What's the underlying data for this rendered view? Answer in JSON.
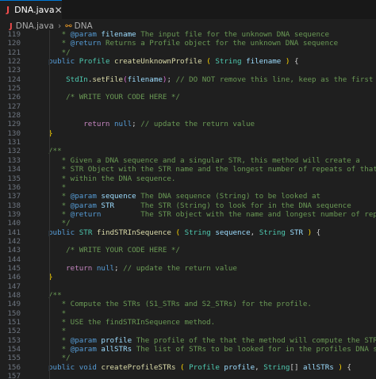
{
  "tab": {
    "label": "DNA.java",
    "icon": "java-file-icon",
    "accent": "#0078d4"
  },
  "breadcrumb": {
    "file": "DNA.java",
    "symbol": "DNA"
  },
  "colors": {
    "background": "#1f1f1f",
    "comment": "#6a9955",
    "type": "#4ec9b0",
    "function": "#dcdcaa",
    "variable": "#9cdcfe",
    "keyword": "#569cd6",
    "control": "#c586c0",
    "line_number": "#6e7681"
  },
  "lines": [
    {
      "n": "119",
      "s": [
        [
          "c",
          "   * "
        ],
        [
          "tag",
          "@param"
        ],
        [
          "c",
          " "
        ],
        [
          "tp",
          "filename"
        ],
        [
          "c",
          " The input file for the unknown DNA sequence"
        ]
      ]
    },
    {
      "n": "120",
      "s": [
        [
          "c",
          "   * "
        ],
        [
          "tag",
          "@return"
        ],
        [
          "c",
          " Returns a Profile object for the unknown DNA sequence"
        ]
      ]
    },
    {
      "n": "121",
      "s": [
        [
          "c",
          "   */"
        ]
      ]
    },
    {
      "n": "122",
      "s": [
        [
          "k",
          "public"
        ],
        [
          "p",
          " "
        ],
        [
          "t",
          "Profile"
        ],
        [
          "p",
          " "
        ],
        [
          "f",
          "createUnknownProfile"
        ],
        [
          "p",
          " "
        ],
        [
          "y",
          "("
        ],
        [
          "p",
          " "
        ],
        [
          "t",
          "String"
        ],
        [
          "p",
          " "
        ],
        [
          "v",
          "filename"
        ],
        [
          "p",
          " "
        ],
        [
          "y",
          ")"
        ],
        [
          "p",
          " {"
        ]
      ]
    },
    {
      "n": "123",
      "s": []
    },
    {
      "n": "124",
      "s": [
        [
          "p",
          "    "
        ],
        [
          "t",
          "StdIn"
        ],
        [
          "p",
          "."
        ],
        [
          "f",
          "setFile"
        ],
        [
          "pk",
          "("
        ],
        [
          "v",
          "filename"
        ],
        [
          "pk",
          ")"
        ],
        [
          "p",
          "; "
        ],
        [
          "c",
          "// DO NOT remove this line, keep as the first line in the method."
        ]
      ]
    },
    {
      "n": "125",
      "s": []
    },
    {
      "n": "126",
      "s": [
        [
          "p",
          "    "
        ],
        [
          "c",
          "/* WRITE YOUR CODE HERE */"
        ]
      ]
    },
    {
      "n": "127",
      "s": []
    },
    {
      "n": "128",
      "s": []
    },
    {
      "n": "129",
      "s": [
        [
          "p",
          "        "
        ],
        [
          "kc",
          "return"
        ],
        [
          "p",
          " "
        ],
        [
          "k",
          "null"
        ],
        [
          "p",
          "; "
        ],
        [
          "c",
          "// update the return value"
        ]
      ]
    },
    {
      "n": "130",
      "s": [
        [
          "y",
          "}"
        ]
      ]
    },
    {
      "n": "131",
      "s": []
    },
    {
      "n": "132",
      "s": [
        [
          "c",
          "/**"
        ]
      ]
    },
    {
      "n": "133",
      "s": [
        [
          "c",
          "   * Given a DNA sequence and a singular STR, this method will create a"
        ]
      ]
    },
    {
      "n": "134",
      "s": [
        [
          "c",
          "   * STR Object with the STR name and the longest number of repeats of that STR"
        ]
      ]
    },
    {
      "n": "135",
      "s": [
        [
          "c",
          "   * within the DNA sequence."
        ]
      ]
    },
    {
      "n": "136",
      "s": [
        [
          "c",
          "   *"
        ]
      ]
    },
    {
      "n": "137",
      "s": [
        [
          "c",
          "   * "
        ],
        [
          "tag",
          "@param"
        ],
        [
          "c",
          " "
        ],
        [
          "tp",
          "sequence"
        ],
        [
          "c",
          " The DNA sequence (String) to be looked at"
        ]
      ]
    },
    {
      "n": "138",
      "s": [
        [
          "c",
          "   * "
        ],
        [
          "tag",
          "@param"
        ],
        [
          "c",
          " "
        ],
        [
          "tp",
          "STR"
        ],
        [
          "c",
          "      The STR (String) to look for in the DNA sequence"
        ]
      ]
    },
    {
      "n": "139",
      "s": [
        [
          "c",
          "   * "
        ],
        [
          "tag",
          "@return"
        ],
        [
          "c",
          "         The STR object with the name and longest number of repeats"
        ]
      ]
    },
    {
      "n": "140",
      "s": [
        [
          "c",
          "   */"
        ]
      ]
    },
    {
      "n": "141",
      "s": [
        [
          "k",
          "public"
        ],
        [
          "p",
          " "
        ],
        [
          "t",
          "STR"
        ],
        [
          "p",
          " "
        ],
        [
          "f",
          "findSTRInSequence"
        ],
        [
          "p",
          " "
        ],
        [
          "y",
          "("
        ],
        [
          "p",
          " "
        ],
        [
          "t",
          "String"
        ],
        [
          "p",
          " "
        ],
        [
          "v",
          "sequence"
        ],
        [
          "p",
          ", "
        ],
        [
          "t",
          "String"
        ],
        [
          "p",
          " "
        ],
        [
          "v",
          "STR"
        ],
        [
          "p",
          " "
        ],
        [
          "y",
          ")"
        ],
        [
          "p",
          " {"
        ]
      ]
    },
    {
      "n": "142",
      "s": []
    },
    {
      "n": "143",
      "s": [
        [
          "p",
          "    "
        ],
        [
          "c",
          "/* WRITE YOUR CODE HERE */"
        ]
      ]
    },
    {
      "n": "144",
      "s": []
    },
    {
      "n": "145",
      "s": [
        [
          "p",
          "    "
        ],
        [
          "kc",
          "return"
        ],
        [
          "p",
          " "
        ],
        [
          "k",
          "null"
        ],
        [
          "p",
          "; "
        ],
        [
          "c",
          "// update the return value"
        ]
      ]
    },
    {
      "n": "146",
      "s": [
        [
          "y",
          "}"
        ]
      ]
    },
    {
      "n": "147",
      "s": []
    },
    {
      "n": "148",
      "s": [
        [
          "c",
          "/**"
        ]
      ]
    },
    {
      "n": "149",
      "s": [
        [
          "c",
          "   * Compute the STRs (S1_STRs and S2_STRs) for the profile."
        ]
      ]
    },
    {
      "n": "150",
      "s": [
        [
          "c",
          "   *"
        ]
      ]
    },
    {
      "n": "151",
      "s": [
        [
          "c",
          "   * USE the findSTRInSequence method."
        ]
      ]
    },
    {
      "n": "152",
      "s": [
        [
          "c",
          "   *"
        ]
      ]
    },
    {
      "n": "153",
      "s": [
        [
          "c",
          "   * "
        ],
        [
          "tag",
          "@param"
        ],
        [
          "c",
          " "
        ],
        [
          "tp",
          "profile"
        ],
        [
          "c",
          " The profile of the that the method will compute the STRs array for"
        ]
      ]
    },
    {
      "n": "154",
      "s": [
        [
          "c",
          "   * "
        ],
        [
          "tag",
          "@param"
        ],
        [
          "c",
          " "
        ],
        [
          "tp",
          "allSTRs"
        ],
        [
          "c",
          " The list of STRs to be looked for in the profiles DNA sequences"
        ]
      ]
    },
    {
      "n": "155",
      "s": [
        [
          "c",
          "   */"
        ]
      ]
    },
    {
      "n": "156",
      "s": [
        [
          "k",
          "public"
        ],
        [
          "p",
          " "
        ],
        [
          "k",
          "void"
        ],
        [
          "p",
          " "
        ],
        [
          "f",
          "createProfileSTRs"
        ],
        [
          "p",
          " "
        ],
        [
          "y",
          "("
        ],
        [
          "p",
          " "
        ],
        [
          "t",
          "Profile"
        ],
        [
          "p",
          " "
        ],
        [
          "v",
          "profile"
        ],
        [
          "p",
          ", "
        ],
        [
          "t",
          "String"
        ],
        [
          "p",
          "[] "
        ],
        [
          "v",
          "allSTRs"
        ],
        [
          "p",
          " "
        ],
        [
          "y",
          ")"
        ],
        [
          "p",
          " {"
        ]
      ]
    },
    {
      "n": "157",
      "s": []
    }
  ]
}
